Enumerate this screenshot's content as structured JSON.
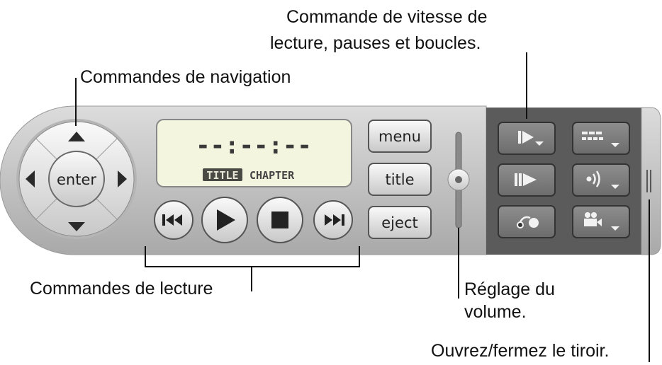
{
  "callouts": {
    "speed_line1": "Commande de vitesse de",
    "speed_line2": "lecture, pauses et boucles.",
    "navigation": "Commandes de navigation",
    "playback": "Commandes de lecture",
    "volume_line1": "Réglage du",
    "volume_line2": "volume.",
    "drawer": "Ouvrez/fermez le tiroir."
  },
  "controller": {
    "enter_label": "enter",
    "display": {
      "time": "--:--:--",
      "title_badge": "TITLE",
      "chapter": "CHAPTER"
    },
    "buttons": {
      "menu": "menu",
      "title": "title",
      "eject": "eject"
    },
    "transport": [
      "previous-chapter-icon",
      "play-icon",
      "stop-icon",
      "next-chapter-icon"
    ],
    "drawer_buttons": [
      "playback-speed-icon",
      "subtitles-icon",
      "step-frame-icon",
      "audio-icon",
      "loop-icon",
      "camera-angle-icon"
    ],
    "colors": {
      "body": "#c4c4c4",
      "drawer": "#5b5b5b",
      "display": "#f3f5df"
    }
  }
}
